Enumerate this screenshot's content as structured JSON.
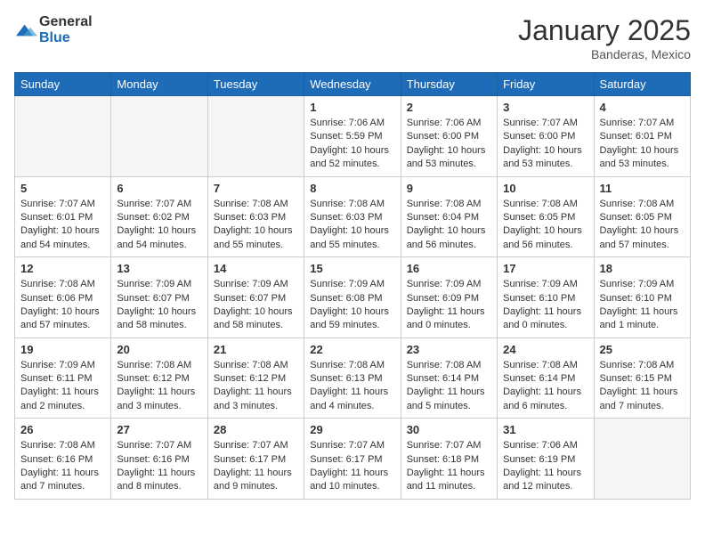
{
  "logo": {
    "general": "General",
    "blue": "Blue"
  },
  "title": "January 2025",
  "location": "Banderas, Mexico",
  "days_of_week": [
    "Sunday",
    "Monday",
    "Tuesday",
    "Wednesday",
    "Thursday",
    "Friday",
    "Saturday"
  ],
  "weeks": [
    [
      {
        "day": "",
        "empty": true
      },
      {
        "day": "",
        "empty": true
      },
      {
        "day": "",
        "empty": true
      },
      {
        "day": "1",
        "sunrise": "Sunrise: 7:06 AM",
        "sunset": "Sunset: 5:59 PM",
        "daylight": "Daylight: 10 hours and 52 minutes."
      },
      {
        "day": "2",
        "sunrise": "Sunrise: 7:06 AM",
        "sunset": "Sunset: 6:00 PM",
        "daylight": "Daylight: 10 hours and 53 minutes."
      },
      {
        "day": "3",
        "sunrise": "Sunrise: 7:07 AM",
        "sunset": "Sunset: 6:00 PM",
        "daylight": "Daylight: 10 hours and 53 minutes."
      },
      {
        "day": "4",
        "sunrise": "Sunrise: 7:07 AM",
        "sunset": "Sunset: 6:01 PM",
        "daylight": "Daylight: 10 hours and 53 minutes."
      }
    ],
    [
      {
        "day": "5",
        "sunrise": "Sunrise: 7:07 AM",
        "sunset": "Sunset: 6:01 PM",
        "daylight": "Daylight: 10 hours and 54 minutes."
      },
      {
        "day": "6",
        "sunrise": "Sunrise: 7:07 AM",
        "sunset": "Sunset: 6:02 PM",
        "daylight": "Daylight: 10 hours and 54 minutes."
      },
      {
        "day": "7",
        "sunrise": "Sunrise: 7:08 AM",
        "sunset": "Sunset: 6:03 PM",
        "daylight": "Daylight: 10 hours and 55 minutes."
      },
      {
        "day": "8",
        "sunrise": "Sunrise: 7:08 AM",
        "sunset": "Sunset: 6:03 PM",
        "daylight": "Daylight: 10 hours and 55 minutes."
      },
      {
        "day": "9",
        "sunrise": "Sunrise: 7:08 AM",
        "sunset": "Sunset: 6:04 PM",
        "daylight": "Daylight: 10 hours and 56 minutes."
      },
      {
        "day": "10",
        "sunrise": "Sunrise: 7:08 AM",
        "sunset": "Sunset: 6:05 PM",
        "daylight": "Daylight: 10 hours and 56 minutes."
      },
      {
        "day": "11",
        "sunrise": "Sunrise: 7:08 AM",
        "sunset": "Sunset: 6:05 PM",
        "daylight": "Daylight: 10 hours and 57 minutes."
      }
    ],
    [
      {
        "day": "12",
        "sunrise": "Sunrise: 7:08 AM",
        "sunset": "Sunset: 6:06 PM",
        "daylight": "Daylight: 10 hours and 57 minutes."
      },
      {
        "day": "13",
        "sunrise": "Sunrise: 7:09 AM",
        "sunset": "Sunset: 6:07 PM",
        "daylight": "Daylight: 10 hours and 58 minutes."
      },
      {
        "day": "14",
        "sunrise": "Sunrise: 7:09 AM",
        "sunset": "Sunset: 6:07 PM",
        "daylight": "Daylight: 10 hours and 58 minutes."
      },
      {
        "day": "15",
        "sunrise": "Sunrise: 7:09 AM",
        "sunset": "Sunset: 6:08 PM",
        "daylight": "Daylight: 10 hours and 59 minutes."
      },
      {
        "day": "16",
        "sunrise": "Sunrise: 7:09 AM",
        "sunset": "Sunset: 6:09 PM",
        "daylight": "Daylight: 11 hours and 0 minutes."
      },
      {
        "day": "17",
        "sunrise": "Sunrise: 7:09 AM",
        "sunset": "Sunset: 6:10 PM",
        "daylight": "Daylight: 11 hours and 0 minutes."
      },
      {
        "day": "18",
        "sunrise": "Sunrise: 7:09 AM",
        "sunset": "Sunset: 6:10 PM",
        "daylight": "Daylight: 11 hours and 1 minute."
      }
    ],
    [
      {
        "day": "19",
        "sunrise": "Sunrise: 7:09 AM",
        "sunset": "Sunset: 6:11 PM",
        "daylight": "Daylight: 11 hours and 2 minutes."
      },
      {
        "day": "20",
        "sunrise": "Sunrise: 7:08 AM",
        "sunset": "Sunset: 6:12 PM",
        "daylight": "Daylight: 11 hours and 3 minutes."
      },
      {
        "day": "21",
        "sunrise": "Sunrise: 7:08 AM",
        "sunset": "Sunset: 6:12 PM",
        "daylight": "Daylight: 11 hours and 3 minutes."
      },
      {
        "day": "22",
        "sunrise": "Sunrise: 7:08 AM",
        "sunset": "Sunset: 6:13 PM",
        "daylight": "Daylight: 11 hours and 4 minutes."
      },
      {
        "day": "23",
        "sunrise": "Sunrise: 7:08 AM",
        "sunset": "Sunset: 6:14 PM",
        "daylight": "Daylight: 11 hours and 5 minutes."
      },
      {
        "day": "24",
        "sunrise": "Sunrise: 7:08 AM",
        "sunset": "Sunset: 6:14 PM",
        "daylight": "Daylight: 11 hours and 6 minutes."
      },
      {
        "day": "25",
        "sunrise": "Sunrise: 7:08 AM",
        "sunset": "Sunset: 6:15 PM",
        "daylight": "Daylight: 11 hours and 7 minutes."
      }
    ],
    [
      {
        "day": "26",
        "sunrise": "Sunrise: 7:08 AM",
        "sunset": "Sunset: 6:16 PM",
        "daylight": "Daylight: 11 hours and 7 minutes."
      },
      {
        "day": "27",
        "sunrise": "Sunrise: 7:07 AM",
        "sunset": "Sunset: 6:16 PM",
        "daylight": "Daylight: 11 hours and 8 minutes."
      },
      {
        "day": "28",
        "sunrise": "Sunrise: 7:07 AM",
        "sunset": "Sunset: 6:17 PM",
        "daylight": "Daylight: 11 hours and 9 minutes."
      },
      {
        "day": "29",
        "sunrise": "Sunrise: 7:07 AM",
        "sunset": "Sunset: 6:17 PM",
        "daylight": "Daylight: 11 hours and 10 minutes."
      },
      {
        "day": "30",
        "sunrise": "Sunrise: 7:07 AM",
        "sunset": "Sunset: 6:18 PM",
        "daylight": "Daylight: 11 hours and 11 minutes."
      },
      {
        "day": "31",
        "sunrise": "Sunrise: 7:06 AM",
        "sunset": "Sunset: 6:19 PM",
        "daylight": "Daylight: 11 hours and 12 minutes."
      },
      {
        "day": "",
        "empty": true
      }
    ]
  ]
}
